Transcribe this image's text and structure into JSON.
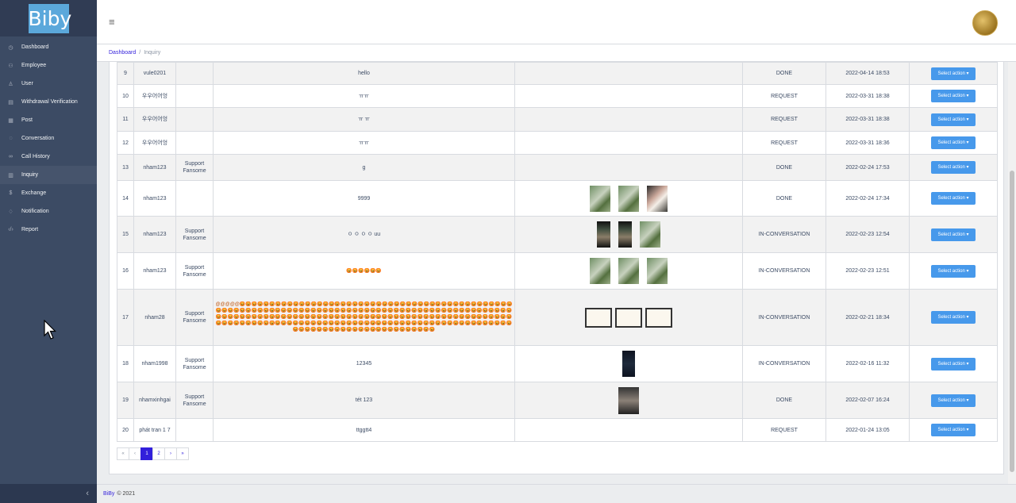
{
  "brand": {
    "logo_text": "Biby"
  },
  "sidebar": {
    "items": [
      {
        "label": "Dashboard",
        "icon": "speedometer-icon"
      },
      {
        "label": "Employee",
        "icon": "people-icon"
      },
      {
        "label": "User",
        "icon": "user-icon"
      },
      {
        "label": "Withdrawal Verification",
        "icon": "document-icon"
      },
      {
        "label": "Post",
        "icon": "newspaper-icon"
      },
      {
        "label": "Conversation",
        "icon": "chat-icon"
      },
      {
        "label": "Call History",
        "icon": "link-icon"
      },
      {
        "label": "Inquiry",
        "icon": "notes-icon"
      },
      {
        "label": "Exchange",
        "icon": "dollar-icon"
      },
      {
        "label": "Notification",
        "icon": "bell-icon"
      },
      {
        "label": "Report",
        "icon": "code-icon"
      }
    ],
    "active": "Inquiry"
  },
  "breadcrumb": {
    "home": "Dashboard",
    "current": "Inquiry"
  },
  "table": {
    "action_label": "Select action",
    "rows": [
      {
        "no": "9",
        "user": "vule0201",
        "assignee": "",
        "content": "hello",
        "status": "DONE",
        "date": "2022-04-14 18:53"
      },
      {
        "no": "10",
        "user": "우우어어엉",
        "assignee": "",
        "content": "ㅠㅠ",
        "status": "REQUEST",
        "date": "2022-03-31 18:38"
      },
      {
        "no": "11",
        "user": "우우어어엉",
        "assignee": "",
        "content": "ㅠ ㅠ",
        "status": "REQUEST",
        "date": "2022-03-31 18:38"
      },
      {
        "no": "12",
        "user": "우우어어엉",
        "assignee": "",
        "content": "ㅠㅠ",
        "status": "REQUEST",
        "date": "2022-03-31 18:36"
      },
      {
        "no": "13",
        "user": "nham123",
        "assignee": "Support Fansome",
        "content": "g",
        "status": "DONE",
        "date": "2022-02-24 17:53"
      },
      {
        "no": "14",
        "user": "nham123",
        "assignee": "",
        "content": "9999",
        "status": "DONE",
        "date": "2022-02-24 17:34"
      },
      {
        "no": "15",
        "user": "nham123",
        "assignee": "Support Fansome",
        "content": "ㅇ ㅇ ㅇ ㅇ uu",
        "status": "IN-CONVERSATION",
        "date": "2022-02-23 12:54"
      },
      {
        "no": "16",
        "user": "nham123",
        "assignee": "Support Fansome",
        "content": "😡😡😡😡😡😡",
        "status": "IN-CONVERSATION",
        "date": "2022-02-23 12:51"
      },
      {
        "no": "17",
        "user": "nham28",
        "assignee": "Support Fansome",
        "content": "@@@@@😡😡😡😡😡😡😡😡😡😡😡😡😡😡😡😡😡😡😡😡😡😡😡😡😡😡😡😡😡😡😡😡😡😡😡😡😡😡😡😡😡😡😡😡😡😡😡😡😡😡😡😡😡😡😡😡😡😡😡😡😡😡😡😡😡😡😡😡😡😡😡😡😡😡😡😡😡😡😡😡😡😡😡😡😡😡😡😡😡😡😡😡😡😡😡😡😡😡😡😡😡😡😡😡😡😡😡😡😡😡😡😡😡😡😡😡😡😡😡😡😡😡😡😡😡😡😡😡😡😡😡😡😡😡😡😡😡😡😡😡😡😡😡😡😡😡😡😡😡😡😡😡😡😡😡😡😡😡😡😡😡😡😡😡😡😡😡😡😡😡😡😡😡😡😡😡😡😡😡😡😡😡😡😡😡😡😡😡😡😡😡😡😡😡😡😡😡😡😡😡😡😡😡😡😡😡😡😡😡😡😡😡😡😡😡😡😡😡😡😡",
        "status": "IN-CONVERSATION",
        "date": "2022-02-21 18:34"
      },
      {
        "no": "18",
        "user": "nham1998",
        "assignee": "Support Fansome",
        "content": "12345",
        "status": "IN-CONVERSATION",
        "date": "2022-02-16 11:32"
      },
      {
        "no": "19",
        "user": "nhamxinhgai",
        "assignee": "Support Fansome",
        "content": "tét 123",
        "status": "DONE",
        "date": "2022-02-07 16:24"
      },
      {
        "no": "20",
        "user": "phát tran 1 7",
        "assignee": "",
        "content": "ttggtt4",
        "status": "REQUEST",
        "date": "2022-01-24 13:05"
      }
    ]
  },
  "pagination": {
    "first": "«",
    "prev": "‹",
    "pages": [
      "1",
      "2"
    ],
    "next": "›",
    "last": "»",
    "active": "1"
  },
  "footer": {
    "brand": "BiBy",
    "copyright": "© 2021"
  }
}
